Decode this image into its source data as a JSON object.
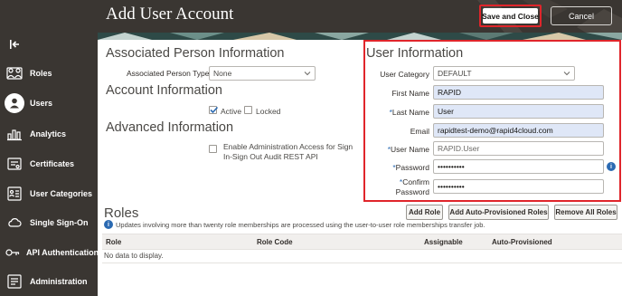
{
  "header": {
    "title": "Add User Account",
    "save_label": "Save and Close",
    "cancel_label": "Cancel"
  },
  "sidebar": {
    "items": [
      {
        "label": "Roles",
        "icon": "roles-icon"
      },
      {
        "label": "Users",
        "icon": "users-icon",
        "active": true
      },
      {
        "label": "Analytics",
        "icon": "analytics-icon"
      },
      {
        "label": "Certificates",
        "icon": "certificates-icon"
      },
      {
        "label": "User Categories",
        "icon": "user-categories-icon"
      },
      {
        "label": "Single Sign-On",
        "icon": "cloud-icon"
      },
      {
        "label": "API Authentication",
        "icon": "key-icon"
      },
      {
        "label": "Administration",
        "icon": "administration-icon"
      }
    ]
  },
  "associated_person": {
    "title": "Associated Person Information",
    "type_label": "Associated Person Type",
    "type_value": "None"
  },
  "account": {
    "title": "Account Information",
    "active_label": "Active",
    "active_checked": true,
    "locked_label": "Locked",
    "locked_checked": false
  },
  "advanced": {
    "title": "Advanced Information",
    "admin_access_label_line1": "Enable Administration Access for Sign",
    "admin_access_label_line2": "In-Sign Out Audit REST API",
    "admin_access_checked": false
  },
  "user_info": {
    "title": "User Information",
    "category_label": "User Category",
    "category_value": "DEFAULT",
    "first_name_label": "First Name",
    "first_name_value": "RAPID",
    "last_name_required": "*",
    "last_name_label": "Last Name",
    "last_name_value": "User",
    "email_label": "Email",
    "email_value": "rapidtest-demo@rapid4cloud.com",
    "user_name_required": "*",
    "user_name_label": "User Name",
    "user_name_value": "RAPID.User",
    "password_required": "*",
    "password_label": "Password",
    "password_value": "••••••••••",
    "confirm_required": "*",
    "confirm_label_line1": "Confirm",
    "confirm_label_line2": "Password",
    "confirm_value": "••••••••••",
    "info_glyph": "i"
  },
  "roles": {
    "title": "Roles",
    "info_glyph": "i",
    "note": "Updates involving more than twenty role memberships are processed using the user-to-user role memberships transfer job.",
    "add_role_label": "Add Role",
    "add_auto_label": "Add Auto-Provisioned Roles",
    "remove_all_label": "Remove All Roles",
    "columns": [
      "Role",
      "Role Code",
      "Assignable",
      "Auto-Provisioned"
    ],
    "empty_text": "No data to display."
  },
  "colors": {
    "chrome": "#3a3632",
    "highlight": "#e0252b",
    "input_filled": "#dfe7f7",
    "accent_blue": "#2b6ab2"
  }
}
